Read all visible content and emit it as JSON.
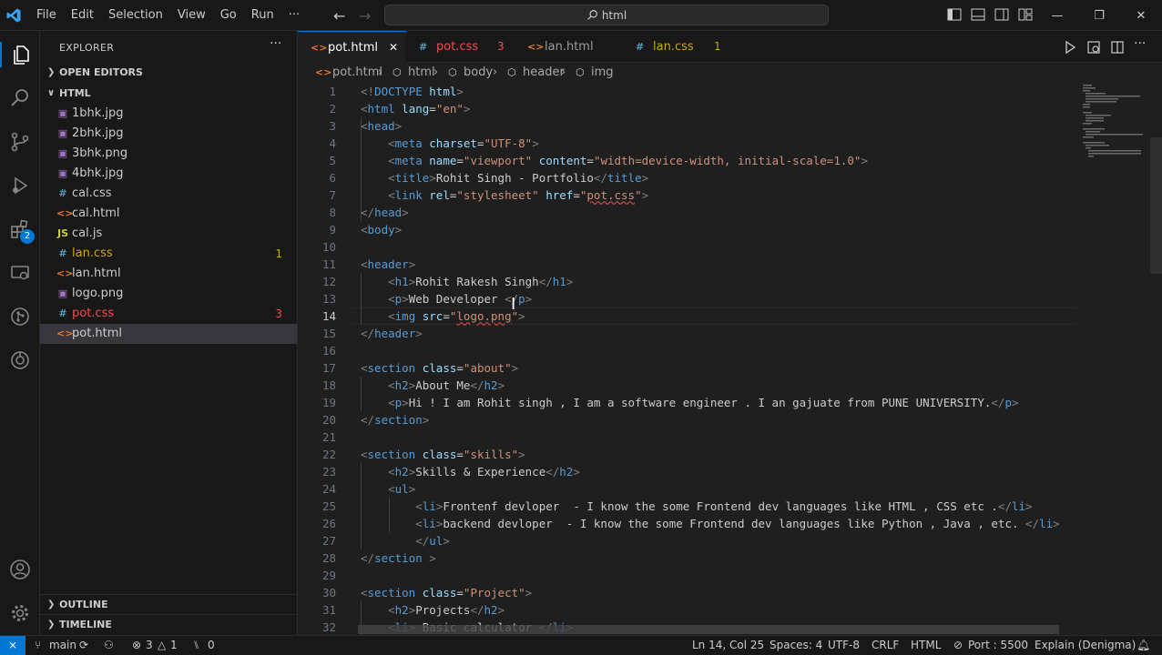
{
  "menu": [
    "File",
    "Edit",
    "Selection",
    "View",
    "Go",
    "Run",
    "···"
  ],
  "command_center": "html",
  "window_controls": {
    "minimize": "—",
    "restore": "❐",
    "close": "✕"
  },
  "activity": {
    "extensions_badge": "2"
  },
  "sidebar": {
    "title": "EXPLORER",
    "more": "···",
    "open_editors": "OPEN EDITORS",
    "folder": "HTML",
    "files": [
      {
        "icon": "▣",
        "name": "1bhk.jpg",
        "badge": "",
        "color": "#cccccc",
        "icon_color": "#a074c4"
      },
      {
        "icon": "▣",
        "name": "2bhk.jpg",
        "badge": "",
        "color": "#cccccc",
        "icon_color": "#a074c4"
      },
      {
        "icon": "▣",
        "name": "3bhk.png",
        "badge": "",
        "color": "#cccccc",
        "icon_color": "#a074c4"
      },
      {
        "icon": "▣",
        "name": "4bhk.jpg",
        "badge": "",
        "color": "#cccccc",
        "icon_color": "#a074c4"
      },
      {
        "icon": "#",
        "name": "cal.css",
        "badge": "",
        "color": "#cccccc",
        "icon_color": "#519aba"
      },
      {
        "icon": "<>",
        "name": "cal.html",
        "badge": "",
        "color": "#cccccc",
        "icon_color": "#e37933"
      },
      {
        "icon": "JS",
        "name": "cal.js",
        "badge": "",
        "color": "#cccccc",
        "icon_color": "#cbcb41"
      },
      {
        "icon": "#",
        "name": "lan.css",
        "badge": "1",
        "color": "#cca700",
        "icon_color": "#519aba"
      },
      {
        "icon": "<>",
        "name": "lan.html",
        "badge": "",
        "color": "#cccccc",
        "icon_color": "#e37933"
      },
      {
        "icon": "▣",
        "name": "logo.png",
        "badge": "",
        "color": "#cccccc",
        "icon_color": "#a074c4"
      },
      {
        "icon": "#",
        "name": "pot.css",
        "badge": "3",
        "color": "#f14c4c",
        "icon_color": "#519aba"
      },
      {
        "icon": "<>",
        "name": "pot.html",
        "badge": "",
        "color": "#cccccc",
        "icon_color": "#e37933"
      }
    ],
    "outline": "OUTLINE",
    "timeline": "TIMELINE"
  },
  "tabs": [
    {
      "icon": "<>",
      "name": "pot.html",
      "badge": "✕",
      "color": "#ffffff",
      "icon_color": "#e37933"
    },
    {
      "icon": "#",
      "name": "pot.css",
      "badge": "3",
      "color": "#f14c4c",
      "icon_color": "#519aba"
    },
    {
      "icon": "<>",
      "name": "lan.html",
      "badge": "",
      "color": "#9d9d9d",
      "icon_color": "#e37933"
    },
    {
      "icon": "#",
      "name": "lan.css",
      "badge": "1",
      "color": "#cca700",
      "icon_color": "#519aba"
    }
  ],
  "breadcrumb": [
    "pot.html",
    "html",
    "body",
    "header",
    "img"
  ],
  "editor": {
    "line_numbers": [
      "1",
      "2",
      "3",
      "4",
      "5",
      "6",
      "7",
      "8",
      "9",
      "10",
      "11",
      "12",
      "13",
      "14",
      "15",
      "16",
      "17",
      "18",
      "19",
      "20",
      "21",
      "22",
      "23",
      "24",
      "25",
      "26",
      "27",
      "28",
      "29",
      "30",
      "31",
      "32"
    ],
    "current_line": 14
  },
  "status": {
    "branch": "main",
    "errors": "3",
    "warnings": "1",
    "ports": "0",
    "cursor": "Ln 14, Col 25",
    "spaces": "Spaces: 4",
    "encoding": "UTF-8",
    "eol": "CRLF",
    "language": "HTML",
    "port": "Port : 5500",
    "explain": "Explain (Denigma)"
  }
}
